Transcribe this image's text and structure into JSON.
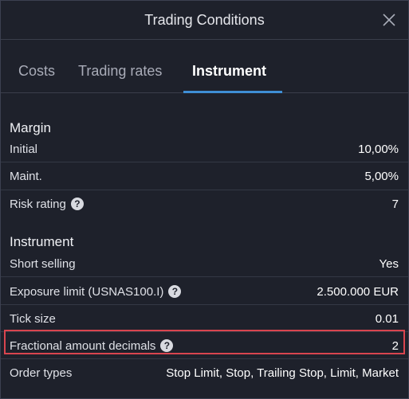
{
  "dialog": {
    "title": "Trading Conditions"
  },
  "tabs": [
    {
      "label": "Costs"
    },
    {
      "label": "Trading rates"
    },
    {
      "label": "Instrument"
    }
  ],
  "margin": {
    "heading": "Margin",
    "rows": [
      {
        "label": "Initial",
        "value": "10,00%"
      },
      {
        "label": "Maint.",
        "value": "5,00%"
      },
      {
        "label": "Risk rating",
        "value": "7",
        "help": "?"
      }
    ]
  },
  "instrument": {
    "heading": "Instrument",
    "rows": [
      {
        "label": "Short selling",
        "value": "Yes"
      },
      {
        "label": "Exposure limit (USNAS100.I)",
        "value": "2.500.000 EUR",
        "help": "?"
      },
      {
        "label": "Tick size",
        "value": "0.01"
      },
      {
        "label": "Fractional amount decimals",
        "value": "2",
        "help": "?"
      },
      {
        "label": "Order types",
        "value": "Stop Limit, Stop, Trailing Stop, Limit, Market"
      }
    ]
  },
  "colors": {
    "background": "#1e212b",
    "accent": "#3f8fd6",
    "highlight": "#d9454f"
  },
  "icons": {
    "close": "close-icon",
    "help": "help-icon"
  }
}
